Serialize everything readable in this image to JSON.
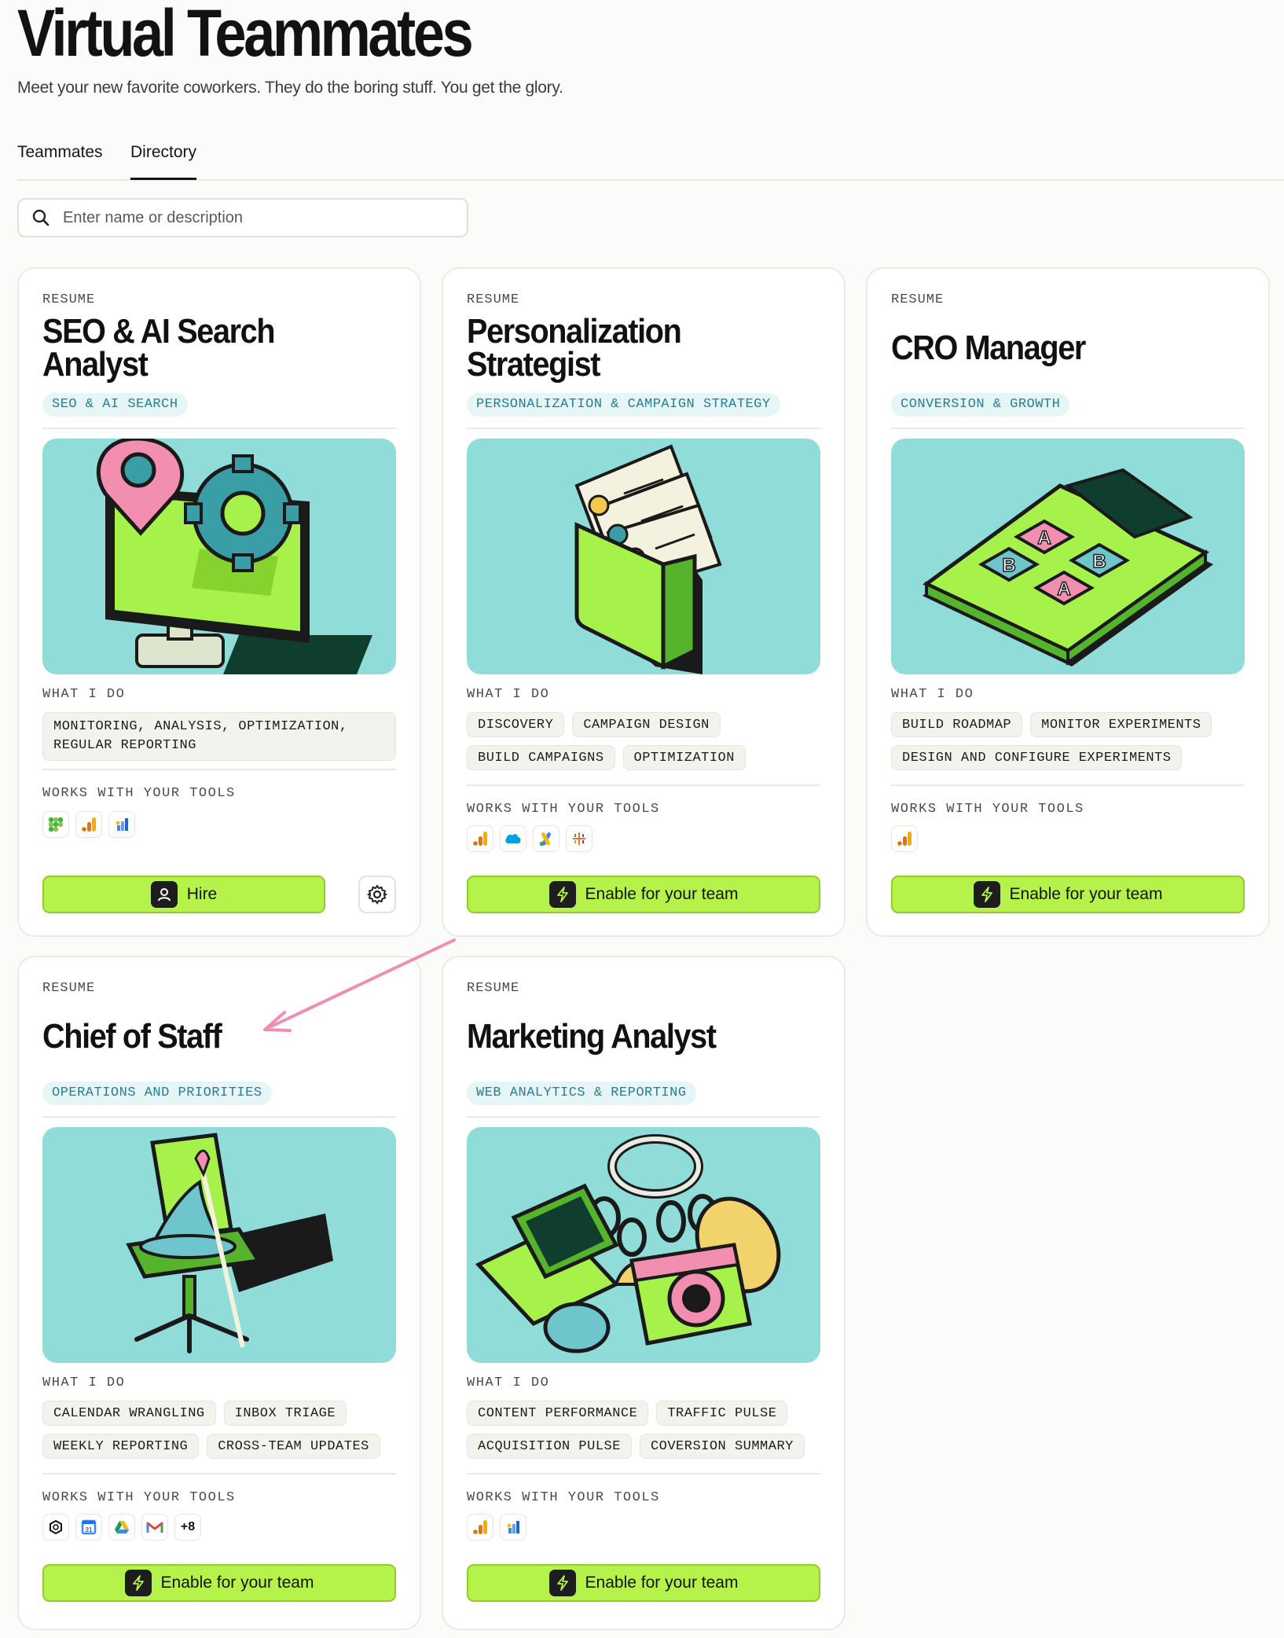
{
  "header": {
    "title": "Virtual Teammates",
    "subtitle": "Meet your new favorite coworkers. They do the boring stuff. You get the glory."
  },
  "tabs": [
    {
      "label": "Teammates",
      "active": false
    },
    {
      "label": "Directory",
      "active": true
    }
  ],
  "search": {
    "placeholder": "Enter name or description",
    "value": ""
  },
  "labels": {
    "resume": "RESUME",
    "what_i_do": "WHAT I DO",
    "works_with": "WORKS WITH YOUR TOOLS"
  },
  "colors": {
    "accent_green": "#b6f34a",
    "illustration_bg": "#90dcd9",
    "category_text": "#2a7d93"
  },
  "cards": [
    {
      "title": "SEO & AI Search Analyst",
      "category": "SEO & AI SEARCH",
      "illustration": "monitor-with-gear-and-location-pin",
      "tasks": [
        "MONITORING, ANALYSIS, OPTIMIZATION, REGULAR REPORTING"
      ],
      "tools": [
        "color-grid-icon",
        "google-analytics-icon",
        "looker-studio-icon"
      ],
      "action": "Hire",
      "action_icon": "user-icon",
      "has_settings": true
    },
    {
      "title": "Personalization Strategist",
      "category": "PERSONALIZATION & CAMPAIGN STRATEGY",
      "illustration": "wallet-with-profile-cards",
      "tasks": [
        "DISCOVERY",
        "CAMPAIGN DESIGN",
        "BUILD CAMPAIGNS",
        "OPTIMIZATION"
      ],
      "tools": [
        "google-analytics-icon",
        "salesforce-icon",
        "google-ads-icon",
        "tableau-icon"
      ],
      "action": "Enable for your team",
      "action_icon": "bolt-icon",
      "has_settings": false
    },
    {
      "title": "CRO Manager",
      "category": "CONVERSION & GROWTH",
      "illustration": "calculator-with-ab-keys",
      "tasks": [
        "BUILD ROADMAP",
        "MONITOR EXPERIMENTS",
        "DESIGN AND CONFIGURE EXPERIMENTS"
      ],
      "tools": [
        "google-analytics-icon"
      ],
      "action": "Enable for your team",
      "action_icon": "bolt-icon",
      "has_settings": false
    },
    {
      "title": "Chief of Staff",
      "category": "OPERATIONS AND PRIORITIES",
      "illustration": "office-chair-with-wizard-hat",
      "tasks": [
        "CALENDAR WRANGLING",
        "INBOX TRIAGE",
        "WEEKLY REPORTING",
        "CROSS-TEAM UPDATES"
      ],
      "tools": [
        "openai-icon",
        "google-calendar-icon",
        "google-drive-icon",
        "gmail-icon"
      ],
      "tools_more": "+8",
      "action": "Enable for your team",
      "action_icon": "bolt-icon",
      "has_settings": false
    },
    {
      "title": "Marketing Analyst",
      "category": "WEB ANALYTICS & REPORTING",
      "illustration": "keyring-with-laptop-camera-mouse",
      "tasks": [
        "CONTENT PERFORMANCE",
        "TRAFFIC PULSE",
        "ACQUISITION PULSE",
        "COVERSION SUMMARY"
      ],
      "tools": [
        "google-analytics-icon",
        "looker-studio-icon"
      ],
      "action": "Enable for your team",
      "action_icon": "bolt-icon",
      "has_settings": false
    }
  ]
}
